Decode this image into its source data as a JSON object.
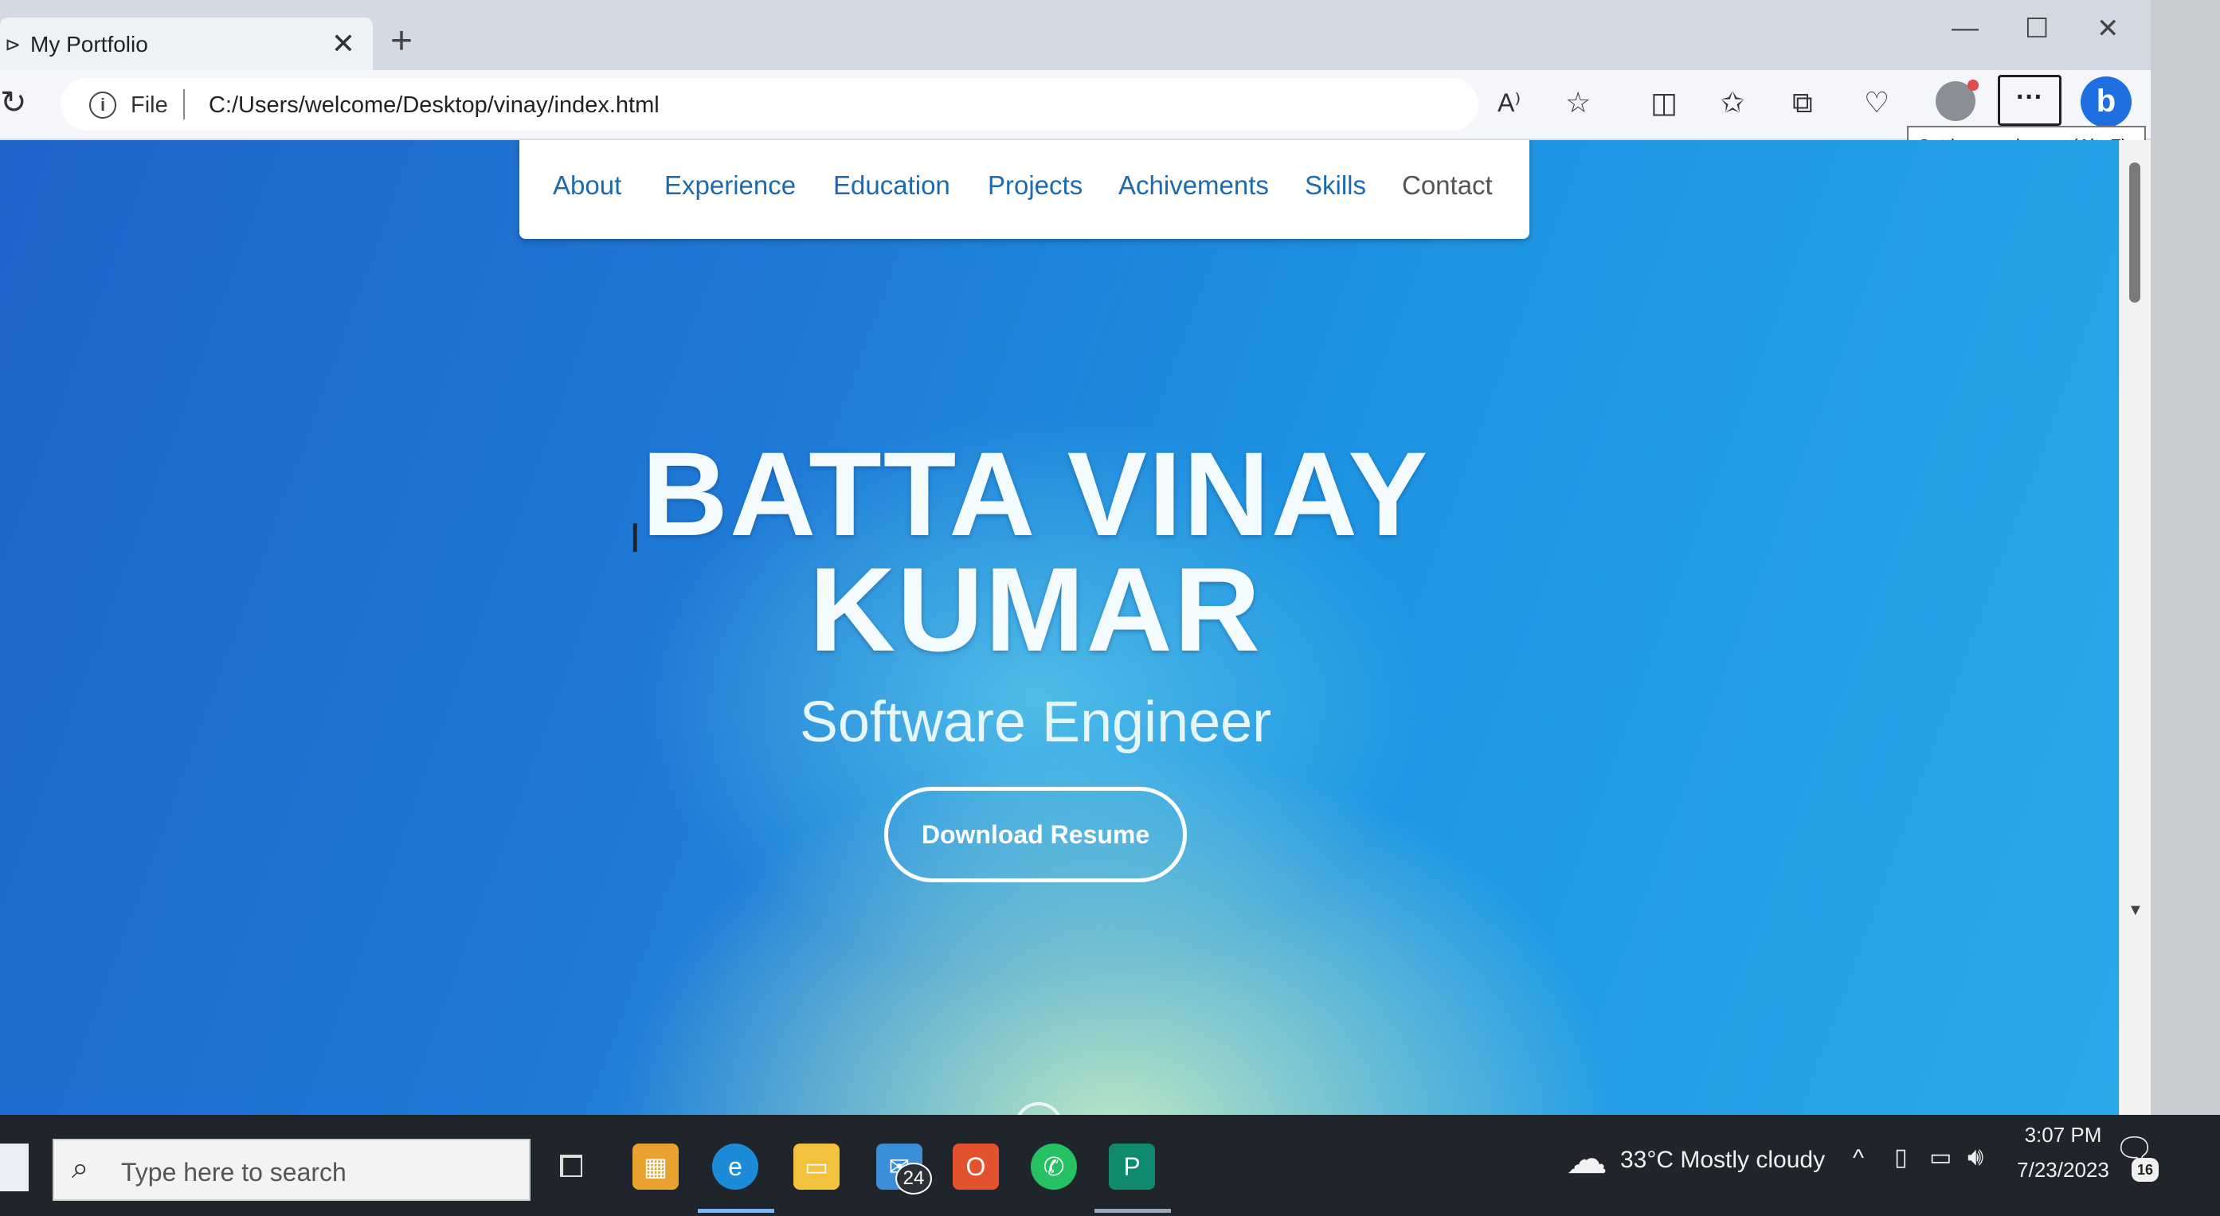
{
  "browser": {
    "tab_title": "My Portfolio",
    "new_tab": "+",
    "tab_close": "✕",
    "address": {
      "scheme_label": "File",
      "url": "C:/Users/welcome/Desktop/vinay/index.html"
    },
    "tooltip": "Settings and more (Alt+F)",
    "more_label": "···",
    "read_aloud_label": "A⁾",
    "copilot_label": "b"
  },
  "page": {
    "nav": [
      "About",
      "Experience",
      "Education",
      "Projects",
      "Achivements",
      "Skills",
      "Contact"
    ],
    "hero": {
      "name_line1": "BATTA VINAY",
      "name_line2": "KUMAR",
      "title": "Software Engineer",
      "button": "Download Resume"
    }
  },
  "taskbar": {
    "search_placeholder": "Type here to search",
    "mail_badge": "24",
    "weather": "33°C  Mostly cloudy",
    "time": "3:07 PM",
    "date": "7/23/2023",
    "notification_count": "16"
  },
  "colors": {
    "nav_link": "#1c6ab0",
    "hero_bg": "#1f7ad6",
    "taskbar_bg": "#20242b"
  }
}
